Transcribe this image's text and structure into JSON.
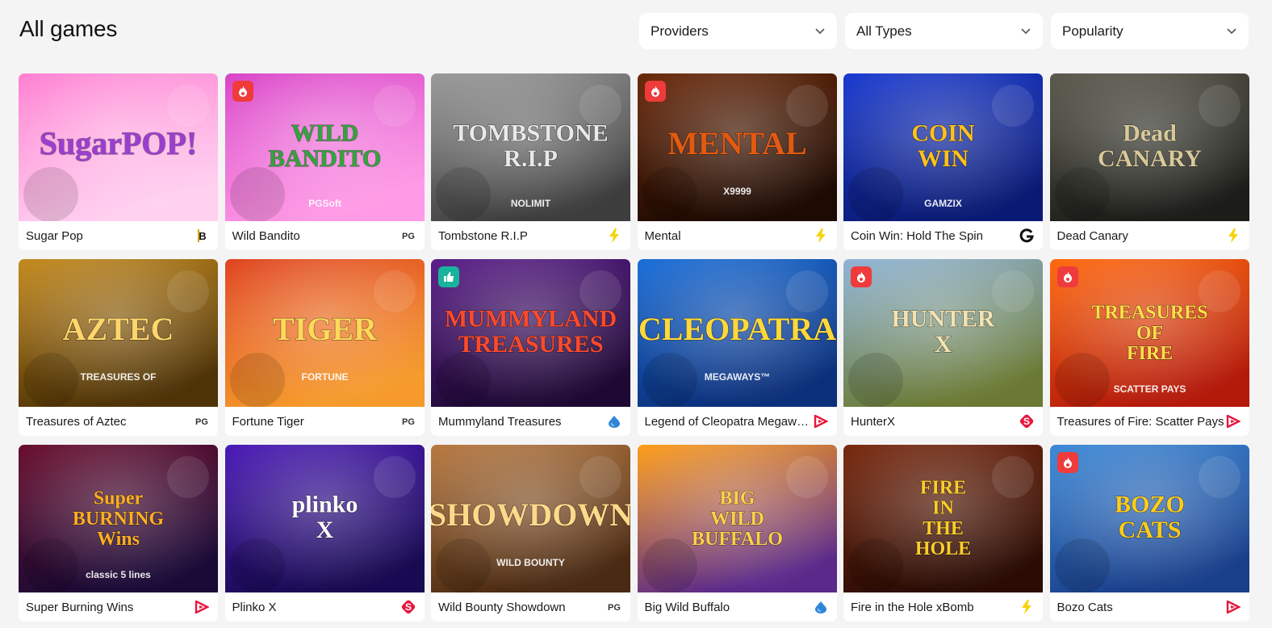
{
  "header": {
    "title": "All games",
    "filters": [
      {
        "label": "Providers"
      },
      {
        "label": "All Types"
      },
      {
        "label": "Popularity"
      }
    ]
  },
  "games": [
    {
      "name": "Sugar Pop",
      "art_text": "SugarPOP!",
      "bg": [
        "#ff7fd1",
        "#ffd0f0"
      ],
      "fg": "#9b3ecf",
      "provider": "bolt-b-icon",
      "badge": ""
    },
    {
      "name": "Wild Bandito",
      "art_text": "WILD BANDITO",
      "art_sub": "PGSoft",
      "bg": [
        "#d944c8",
        "#ff9ae6"
      ],
      "fg": "#2fa63a",
      "provider": "pg-icon",
      "badge": "hot"
    },
    {
      "name": "Tombstone R.I.P",
      "art_text": "TOMBSTONE R.I.P",
      "art_sub": "NOLIMIT",
      "bg": [
        "#9a9a9a",
        "#3d3d3d"
      ],
      "fg": "#e9e9e9",
      "provider": "lightning-icon",
      "badge": ""
    },
    {
      "name": "Mental",
      "art_text": "MENTAL",
      "art_sub": "X9999",
      "bg": [
        "#6b2a0a",
        "#1d0a02"
      ],
      "fg": "#e25a12",
      "provider": "lightning-icon",
      "badge": "hot"
    },
    {
      "name": "Coin Win: Hold The Spin",
      "art_text": "COIN WIN",
      "art_sub": "GAMZIX",
      "bg": [
        "#1b3bd1",
        "#0a1a74"
      ],
      "fg": "#ffc21a",
      "provider": "g-icon",
      "badge": ""
    },
    {
      "name": "Dead Canary",
      "art_text": "Dead CANARY",
      "bg": [
        "#5a5a4e",
        "#1c1c18"
      ],
      "fg": "#d9c99a",
      "provider": "lightning-icon",
      "badge": ""
    },
    {
      "name": "Treasures of Aztec",
      "art_text": "AZTEC",
      "art_sub": "TREASURES OF",
      "bg": [
        "#c48a1e",
        "#4e3306"
      ],
      "fg": "#ffd66b",
      "provider": "pg-icon",
      "badge": ""
    },
    {
      "name": "Fortune Tiger",
      "art_text": "TIGER",
      "art_sub": "FORTUNE",
      "bg": [
        "#e04421",
        "#f59a2b"
      ],
      "fg": "#ffd95a",
      "provider": "pg-icon",
      "badge": ""
    },
    {
      "name": "Mummyland Treasures",
      "art_text": "MUMMYLAND TREASURES",
      "bg": [
        "#5b1e8a",
        "#1e0934"
      ],
      "fg": "#ff4a2a",
      "provider": "drop-icon",
      "badge": "like"
    },
    {
      "name": "Legend of Cleopatra Megaways",
      "art_text": "CLEOPATRA",
      "art_sub": "MEGAWAYS™",
      "bg": [
        "#1b6fd8",
        "#0b2f7a"
      ],
      "fg": "#ffd93a",
      "provider": "play-triangle-icon",
      "badge": ""
    },
    {
      "name": "HunterX",
      "art_text": "HUNTER X",
      "bg": [
        "#8fb4d8",
        "#6a7a34"
      ],
      "fg": "#f4e3b0",
      "provider": "s-icon",
      "badge": "hot"
    },
    {
      "name": "Treasures of Fire: Scatter Pays",
      "art_text": "TREASURES OF FIRE",
      "art_sub": "SCATTER PAYS",
      "bg": [
        "#ff6a10",
        "#b41a0a"
      ],
      "fg": "#ffe04a",
      "provider": "play-triangle-icon",
      "badge": "hot"
    },
    {
      "name": "Super Burning Wins",
      "art_text": "Super BURNING Wins",
      "art_sub": "classic 5 lines",
      "bg": [
        "#6a0f2e",
        "#1a0a36"
      ],
      "fg": "#ffb020",
      "provider": "play-triangle-icon",
      "badge": ""
    },
    {
      "name": "Plinko X",
      "art_text": "plinko X",
      "bg": [
        "#4b1bb8",
        "#180a52"
      ],
      "fg": "#ffffff",
      "provider": "s-icon",
      "badge": ""
    },
    {
      "name": "Wild Bounty Showdown",
      "art_text": "SHOWDOWN",
      "art_sub": "WILD BOUNTY",
      "bg": [
        "#b87a42",
        "#4a2a12"
      ],
      "fg": "#ffd98a",
      "provider": "pg-icon",
      "badge": ""
    },
    {
      "name": "Big Wild Buffalo",
      "art_text": "BIG WILD BUFFALO",
      "bg": [
        "#ff9e1a",
        "#5a2a8a"
      ],
      "fg": "#ffd24a",
      "provider": "drop-icon",
      "badge": ""
    },
    {
      "name": "Fire in the Hole xBomb",
      "art_text": "FIRE IN THE HOLE",
      "bg": [
        "#7a2a10",
        "#2a0c04"
      ],
      "fg": "#ffcf2a",
      "provider": "lightning-icon",
      "badge": ""
    },
    {
      "name": "Bozo Cats",
      "art_text": "BOZO CATS",
      "bg": [
        "#3e8ad8",
        "#1a3f8a"
      ],
      "fg": "#ffcc1a",
      "provider": "play-triangle-icon",
      "badge": "hot"
    }
  ],
  "colors": {
    "page_bg": "#f4f4f5",
    "hot_badge": "#ef3b3b",
    "like_badge": "#19b39c",
    "provider_red": "#e8163d",
    "provider_yellow": "#f6d30c"
  }
}
